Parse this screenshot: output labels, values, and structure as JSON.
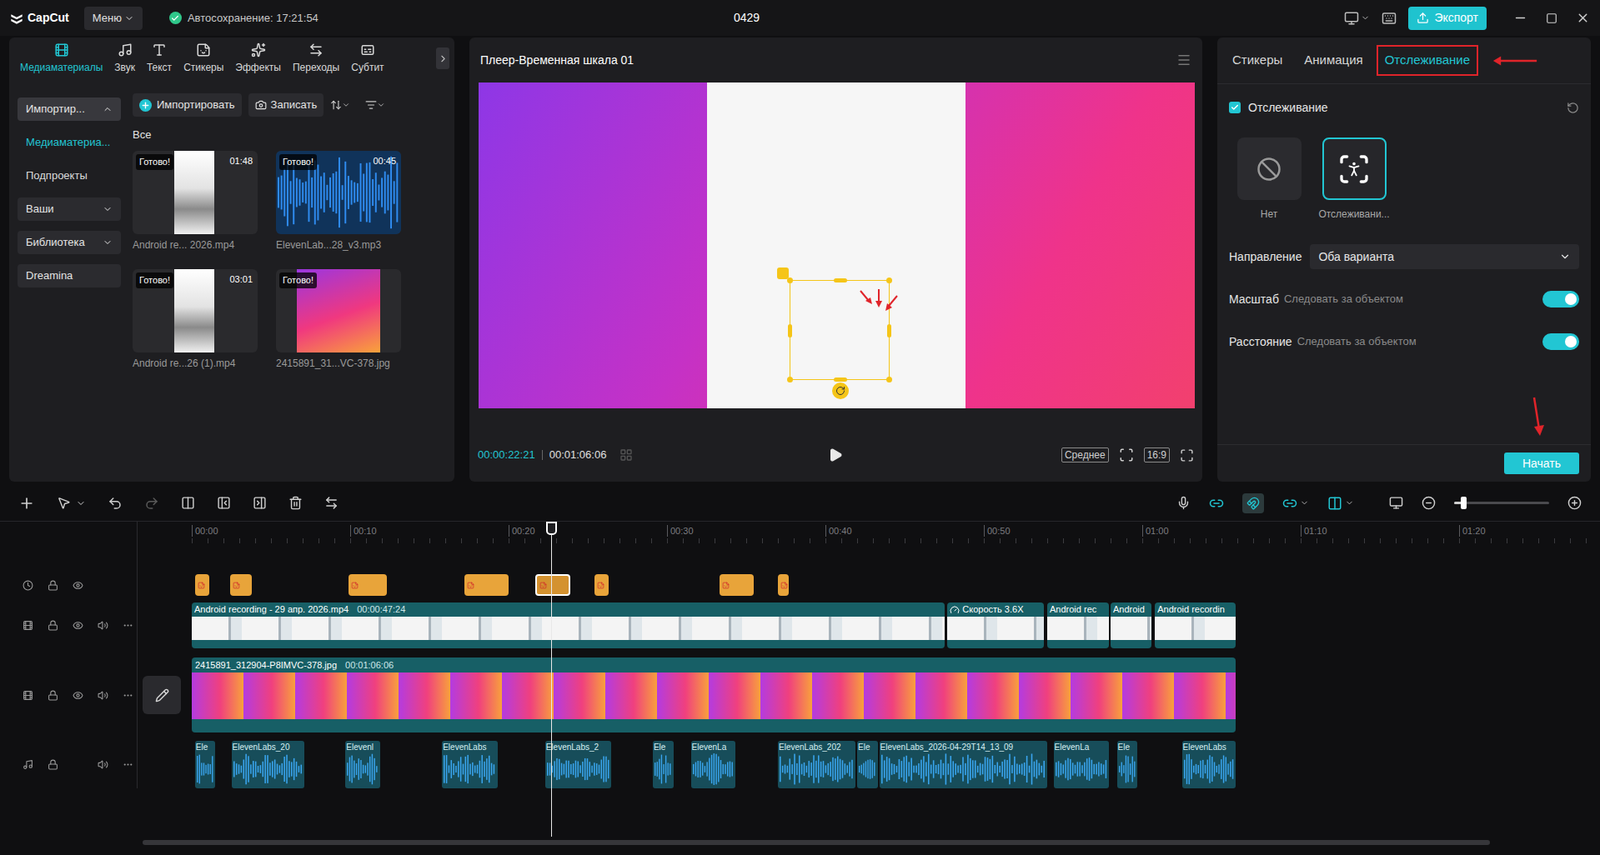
{
  "titlebar": {
    "app": "CapCut",
    "menu": "Меню",
    "autosave": "Автосохранение: 17:21:54",
    "project": "0429",
    "export": "Экспорт"
  },
  "media_panel": {
    "tabs": [
      {
        "label": "Медиаматериалы",
        "selected": true
      },
      {
        "label": "Звук",
        "selected": false
      },
      {
        "label": "Текст",
        "selected": false
      },
      {
        "label": "Стикеры",
        "selected": false
      },
      {
        "label": "Эффекты",
        "selected": false
      },
      {
        "label": "Переходы",
        "selected": false
      },
      {
        "label": "Субтит",
        "selected": false
      }
    ],
    "sidebar": [
      {
        "label": "Импортир...",
        "kind": "dropdown",
        "expanded": true,
        "selected": true
      },
      {
        "label": "Медиаматериа...",
        "kind": "link",
        "selected": true
      },
      {
        "label": "Подпроекты",
        "kind": "link",
        "selected": false
      },
      {
        "label": "Ваши",
        "kind": "dropdown",
        "expanded": false,
        "selected": false
      },
      {
        "label": "Библиотека",
        "kind": "dropdown",
        "expanded": false,
        "selected": false
      },
      {
        "label": "Dreamina",
        "kind": "button",
        "selected": false
      }
    ],
    "import_button": "Импортировать",
    "record_button": "Записать",
    "filter": "Все",
    "items": [
      {
        "name": "Android re... 2026.mp4",
        "status": "Готово!",
        "duration": "01:48",
        "kind": "video"
      },
      {
        "name": "ElevenLab...28_v3.mp3",
        "status": "Готово!",
        "duration": "00:45",
        "kind": "audio"
      },
      {
        "name": "Android re...26 (1).mp4",
        "status": "Готово!",
        "duration": "03:01",
        "kind": "video"
      },
      {
        "name": "2415891_31...VC-378.jpg",
        "status": "Готово!",
        "kind": "image"
      }
    ]
  },
  "player": {
    "title": "Плеер-Временная шкала 01",
    "current_time": "00:00:22:21",
    "total_time": "00:01:06:06",
    "quality": "Среднее",
    "aspect": "16:9"
  },
  "inspector": {
    "tabs": [
      {
        "label": "Стикеры",
        "selected": false
      },
      {
        "label": "Анимация",
        "selected": false
      },
      {
        "label": "Отслеживание",
        "selected": true
      }
    ],
    "tracking": {
      "label": "Отслеживание",
      "checked": true
    },
    "modes": [
      {
        "label": "Нет",
        "kind": "none",
        "selected": false
      },
      {
        "label": "Отслеживани...",
        "kind": "track",
        "selected": true
      }
    ],
    "settings": [
      {
        "label": "Направление",
        "kind": "select",
        "value": "Оба варианта"
      },
      {
        "label": "Масштаб",
        "kind": "toggle",
        "value": "Следовать за объектом",
        "on": true
      },
      {
        "label": "Расстояние",
        "kind": "toggle",
        "value": "Следовать за объектом",
        "on": true
      }
    ],
    "start_button": "Начать"
  },
  "timeline": {
    "zoom_level": 0.1,
    "playhead_seconds": 22.7,
    "ruler": [
      "00:00",
      "00:10",
      "00:20",
      "00:30",
      "00:40",
      "00:50",
      "01:00",
      "01:10",
      "01:20"
    ],
    "sticker_clips": [
      {
        "start": 0.2,
        "end": 1.1,
        "selected": false
      },
      {
        "start": 2.4,
        "end": 3.8,
        "selected": false
      },
      {
        "start": 9.9,
        "end": 12.3,
        "selected": false
      },
      {
        "start": 17.2,
        "end": 20.0,
        "selected": false
      },
      {
        "start": 21.7,
        "end": 23.9,
        "selected": true
      },
      {
        "start": 25.4,
        "end": 26.3,
        "selected": false
      },
      {
        "start": 33.3,
        "end": 35.5,
        "selected": false
      },
      {
        "start": 37.0,
        "end": 37.7,
        "selected": false
      }
    ],
    "video_clips": [
      {
        "label": "Android recording - 29 апр. 2026.mp4",
        "duration": "00:00:47:24",
        "kind": "clip",
        "start": 0,
        "end": 47.5
      },
      {
        "label": "Скорость 3.6X",
        "kind": "speed",
        "start": 47.7,
        "end": 53.8
      },
      {
        "label": "Android rec",
        "kind": "clip",
        "start": 54.0,
        "end": 57.9
      },
      {
        "label": "Android",
        "kind": "clip",
        "start": 58.0,
        "end": 60.6
      },
      {
        "label": "Android recordin",
        "kind": "clip",
        "start": 60.8,
        "end": 65.9
      }
    ],
    "image_clips": [
      {
        "label": "2415891_312904-P8IMVC-378.jpg",
        "duration": "00:01:06:06",
        "start": 0,
        "end": 65.9
      }
    ],
    "audio_clips": [
      {
        "label": "Ele",
        "start": 0.2,
        "end": 1.5
      },
      {
        "label": "ElevenLabs_20",
        "start": 2.5,
        "end": 7.1
      },
      {
        "label": "Elevenl",
        "start": 9.7,
        "end": 11.9
      },
      {
        "label": "ElevenLabs",
        "start": 15.8,
        "end": 19.3
      },
      {
        "label": "ElevenLabs_2",
        "start": 22.3,
        "end": 26.5
      },
      {
        "label": "Ele",
        "start": 29.1,
        "end": 30.4
      },
      {
        "label": "ElevenLa",
        "start": 31.5,
        "end": 34.3
      },
      {
        "label": "ElevenLabs_202",
        "start": 37.0,
        "end": 41.9
      },
      {
        "label": "Ele",
        "start": 42.0,
        "end": 43.3
      },
      {
        "label": "ElevenLabs_2026-04-29T14_13_09",
        "start": 43.4,
        "end": 54.0
      },
      {
        "label": "ElevenLa",
        "start": 54.4,
        "end": 57.9
      },
      {
        "label": "Ele",
        "start": 58.4,
        "end": 59.7
      },
      {
        "label": "ElevenLabs",
        "start": 62.5,
        "end": 65.9
      }
    ]
  }
}
